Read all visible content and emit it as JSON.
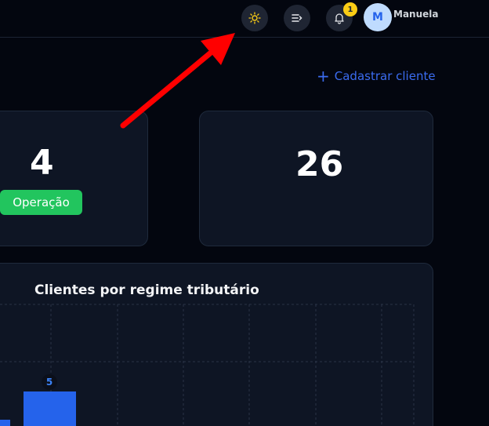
{
  "topbar": {
    "theme_icon": "sun-icon",
    "menu_icon": "menu-collapse-icon",
    "notifications_icon": "bell-icon",
    "notifications_count": "1",
    "avatar_initial": "M",
    "user_name": "Manuela"
  },
  "actions": {
    "add_client_label": "Cadastrar cliente",
    "add_client_icon": "plus-icon"
  },
  "stats": [
    {
      "value": "4",
      "badge": "Operação"
    },
    {
      "value": "26"
    }
  ],
  "chart": {
    "title": "Clientes por regime tributário"
  },
  "chart_data": {
    "type": "bar",
    "title": "Clientes por regime tributário",
    "visible_value_labels": [
      "5"
    ],
    "values": [
      5
    ],
    "bar_color": "#2563eb"
  },
  "colors": {
    "background": "#03060f",
    "card": "#0e1524",
    "accent": "#3b6cf0",
    "success": "#22c55e",
    "badge": "#facc15",
    "annotation_arrow": "#ff0000"
  }
}
